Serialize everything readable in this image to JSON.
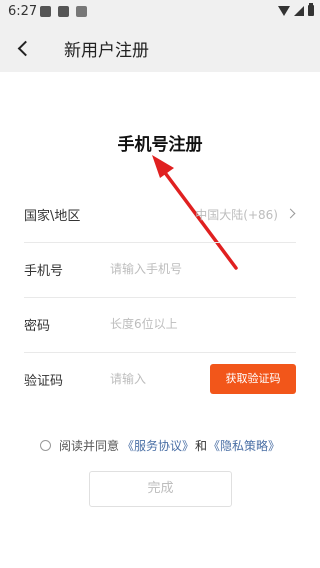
{
  "status_bar": {
    "time": "6:27"
  },
  "header": {
    "title": "新用户注册"
  },
  "page_title": "手机号注册",
  "form": {
    "region": {
      "label": "国家\\地区",
      "value": "中国大陆(+86)"
    },
    "phone": {
      "label": "手机号",
      "placeholder": "请输入手机号"
    },
    "password": {
      "label": "密码",
      "placeholder": "长度6位以上"
    },
    "code": {
      "label": "验证码",
      "placeholder": "请输入",
      "button": "获取验证码"
    }
  },
  "agreement": {
    "prefix": "阅读并同意",
    "service_link": "《服务协议》",
    "conjunction": "和",
    "privacy_link": "《隐私策略》"
  },
  "done_button": "完成",
  "colors": {
    "accent": "#f2561a",
    "link": "#4a6fa5",
    "annotation_arrow": "#e02020"
  }
}
